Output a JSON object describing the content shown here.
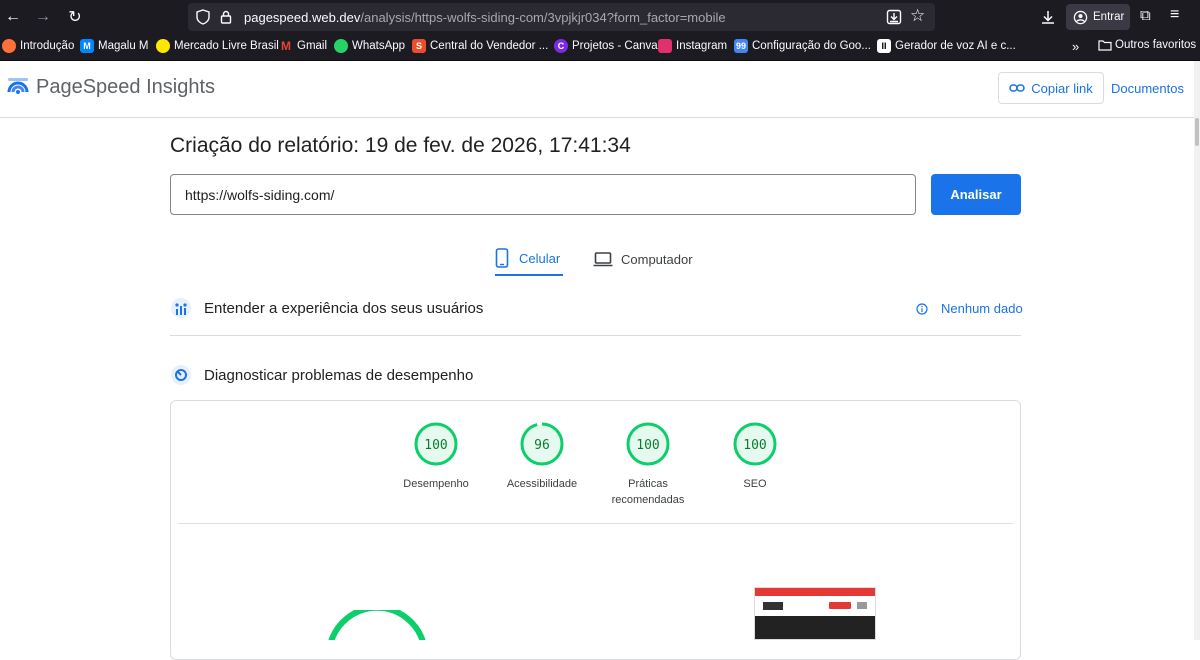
{
  "browser": {
    "url_domain": "pagespeed.web.dev",
    "url_path": "/analysis/https-wolfs-siding-com/3vpjkjr034?form_factor=mobile",
    "signin_label": "Entrar"
  },
  "bookmarks": [
    {
      "label": "Introdução",
      "icon": "firefox-icon",
      "color": "#ff7139"
    },
    {
      "label": "Magalu M",
      "icon": "magalu-icon",
      "color": "#0086ff"
    },
    {
      "label": "Mercado Livre Brasil",
      "icon": "mercadolivre-icon",
      "color": "#ffe600"
    },
    {
      "label": "Gmail",
      "icon": "gmail-icon",
      "color": "#ea4335"
    },
    {
      "label": "WhatsApp",
      "icon": "whatsapp-icon",
      "color": "#25d366"
    },
    {
      "label": "Central do Vendedor ...",
      "icon": "shopee-icon",
      "color": "#ee4d2d"
    },
    {
      "label": "Projetos - Canva",
      "icon": "canva-icon",
      "color": "#7d2ae8"
    },
    {
      "label": "Instagram",
      "icon": "instagram-icon",
      "color": "#e1306c"
    },
    {
      "label": "Configuração do Goo...",
      "icon": "google99-icon",
      "color": "#4285f4"
    },
    {
      "label": "Gerador de voz AI e c...",
      "icon": "voice-icon",
      "color": "#ffffff"
    }
  ],
  "bookmarks_more": "Outros favoritos",
  "header": {
    "title": "PageSpeed Insights",
    "copy_link": "Copiar link",
    "docs": "Documentos"
  },
  "report": {
    "title": "Criação do relatório: 19 de fev. de 2026, 17:41:34",
    "url_value": "https://wolfs-siding.com/",
    "analyze_label": "Analisar"
  },
  "tabs": [
    {
      "label": "Celular",
      "active": true
    },
    {
      "label": "Computador",
      "active": false
    }
  ],
  "ux_section": {
    "title": "Entender a experiência dos seus usuários",
    "no_data": "Nenhum dado"
  },
  "diag_section": {
    "title": "Diagnosticar problemas de desempenho"
  },
  "scores": [
    {
      "value": 100,
      "label": "Desempenho"
    },
    {
      "value": 96,
      "label": "Acessibilidade"
    },
    {
      "value": 100,
      "label": "Práticas recomendadas"
    },
    {
      "value": 100,
      "label": "SEO"
    }
  ],
  "colors": {
    "accent": "#1a73e8",
    "pass": "#0cce6b",
    "pass_text": "#0c7c33"
  }
}
